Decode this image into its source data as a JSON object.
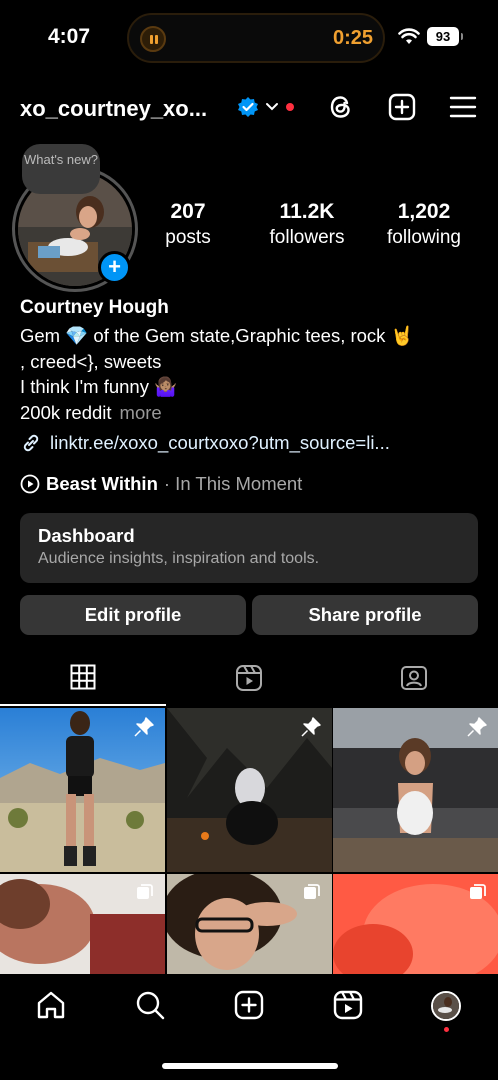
{
  "status_bar": {
    "time": "4:07",
    "timer": "0:25",
    "battery": "93"
  },
  "header": {
    "username": "xo_courtney_xo...",
    "icons": [
      "verified-badge-icon",
      "chevron-down-icon",
      "threads-icon",
      "create-post-icon",
      "menu-icon"
    ]
  },
  "profile": {
    "note": "What's new?",
    "stats": [
      {
        "num": "207",
        "label": "posts"
      },
      {
        "num": "11.2K",
        "label": "followers"
      },
      {
        "num": "1,202",
        "label": "following"
      }
    ],
    "name": "Courtney Hough",
    "bio_line1": "Gem 💎 of the Gem state,Graphic tees, rock 🤘",
    "bio_line2": ", creed<}, sweets",
    "bio_line3": "I think I'm funny 🤷🏽‍♀️",
    "bio_line4": "200k reddit",
    "more": "more",
    "link": "linktr.ee/xoxo_courtxoxo?utm_source=li...",
    "song": "Beast Within",
    "artist": "· In This Moment"
  },
  "dashboard": {
    "title": "Dashboard",
    "subtitle": "Audience insights, inspiration and tools."
  },
  "buttons": {
    "edit": "Edit profile",
    "share": "Share profile"
  },
  "tabs": [
    "grid-icon",
    "reels-icon",
    "tagged-icon"
  ],
  "nav": [
    "home-icon",
    "search-icon",
    "create-icon",
    "reels-icon",
    "profile-avatar"
  ],
  "colors": {
    "accent": "#0095f6",
    "notification": "#ff3040",
    "timer": "#f0a030"
  }
}
